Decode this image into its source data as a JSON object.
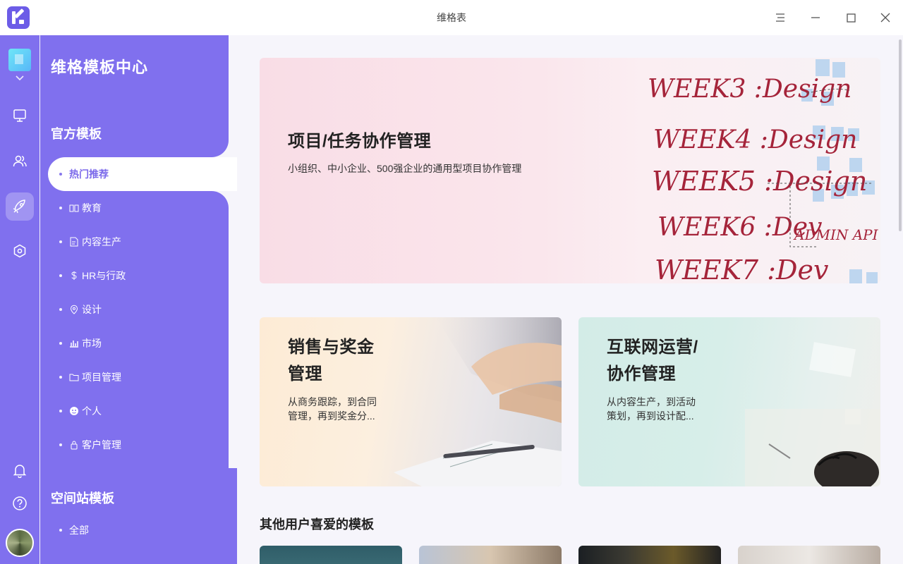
{
  "window": {
    "title": "维格表"
  },
  "sidebar": {
    "title": "维格模板中心",
    "official_section": "官方模板",
    "space_section": "空间站模板",
    "items": [
      {
        "label": "热门推荐",
        "icon": "none"
      },
      {
        "label": "教育",
        "icon": "book-icon"
      },
      {
        "label": "内容生产",
        "icon": "document-icon"
      },
      {
        "label": "HR与行政",
        "icon": "dollar-icon"
      },
      {
        "label": "设计",
        "icon": "pin-icon"
      },
      {
        "label": "市场",
        "icon": "bar-chart-icon"
      },
      {
        "label": "项目管理",
        "icon": "folder-icon"
      },
      {
        "label": "个人",
        "icon": "face-icon"
      },
      {
        "label": "客户管理",
        "icon": "lock-icon"
      }
    ],
    "space_items": [
      {
        "label": "全部"
      }
    ]
  },
  "rail": {
    "icons": [
      "monitor-icon",
      "people-icon",
      "rocket-icon",
      "hexagon-icon",
      "bell-icon",
      "help-icon"
    ],
    "active": "rocket-icon"
  },
  "main": {
    "hero": {
      "title": "项目/任务协作管理",
      "desc": "小组织、中小企业、500强企业的通用型项目协作管理",
      "board_words": [
        "WEEK3 :Design",
        "WEEK4 :Design",
        "WEEK5 :Design",
        "WEEK6 :Dev",
        "WEEK7 :Dev",
        "ADMIN API"
      ]
    },
    "sales_card": {
      "title_line1": "销售与奖金",
      "title_line2": "管理",
      "desc_line1": "从商务跟踪，到合同",
      "desc_line2": "管理，再到奖金分..."
    },
    "ops_card": {
      "title_line1": "互联网运营/",
      "title_line2": "协作管理",
      "desc_line1": "从内容生产，到活动",
      "desc_line2": "策划，再到设计配..."
    },
    "others_heading": "其他用户喜爱的模板"
  },
  "colors": {
    "brand": "#7b6aee",
    "sidebar_bg": "#8070ee",
    "active_text": "#7a68ea",
    "main_bg": "#f6f5fb"
  }
}
